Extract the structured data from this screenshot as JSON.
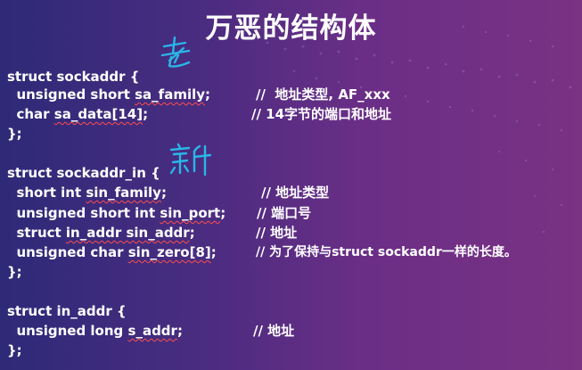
{
  "title": "万恶的结构体",
  "handwritten": {
    "old": "老",
    "new": "新"
  },
  "block1": {
    "line1": "struct sockaddr {",
    "line2_prefix": "  unsigned short ",
    "line2_field": "sa_family",
    "line2_suffix": ";",
    "line2_comment": "//  地址类型, AF_xxx",
    "line3_prefix": "  char ",
    "line3_field": "sa_data[14]",
    "line3_suffix": ";",
    "line3_comment": "// 14字节的端口和地址",
    "line4": "};"
  },
  "block2": {
    "line1": "struct sockaddr_in {",
    "line2_prefix": "  short int ",
    "line2_field": "sin_family",
    "line2_suffix": ";",
    "line2_comment": "// 地址类型",
    "line3_prefix": "  unsigned short int ",
    "line3_field": "sin_port",
    "line3_suffix": ";",
    "line3_comment": "// 端口号",
    "line4_prefix": "  struct ",
    "line4_field": "in_addr sin_addr",
    "line4_suffix": ";",
    "line4_comment": "// 地址",
    "line5_prefix": "  unsigned char ",
    "line5_field": "sin_zero[8]",
    "line5_suffix": ";",
    "line5_comment": "// 为了保持与struct sockaddr一样的长度。",
    "line6": "};"
  },
  "block3": {
    "line1": "struct in_addr {",
    "line2_prefix": "  unsigned long ",
    "line2_field": "s_addr",
    "line2_suffix": ";",
    "line2_comment": "// 地址",
    "line3": "};"
  },
  "colors": {
    "background_left": "#2e2a78",
    "background_right": "#7a3283",
    "text": "#ffffff",
    "handwriting": "#29b6e8",
    "spell_underline": "#ff4d4d"
  }
}
